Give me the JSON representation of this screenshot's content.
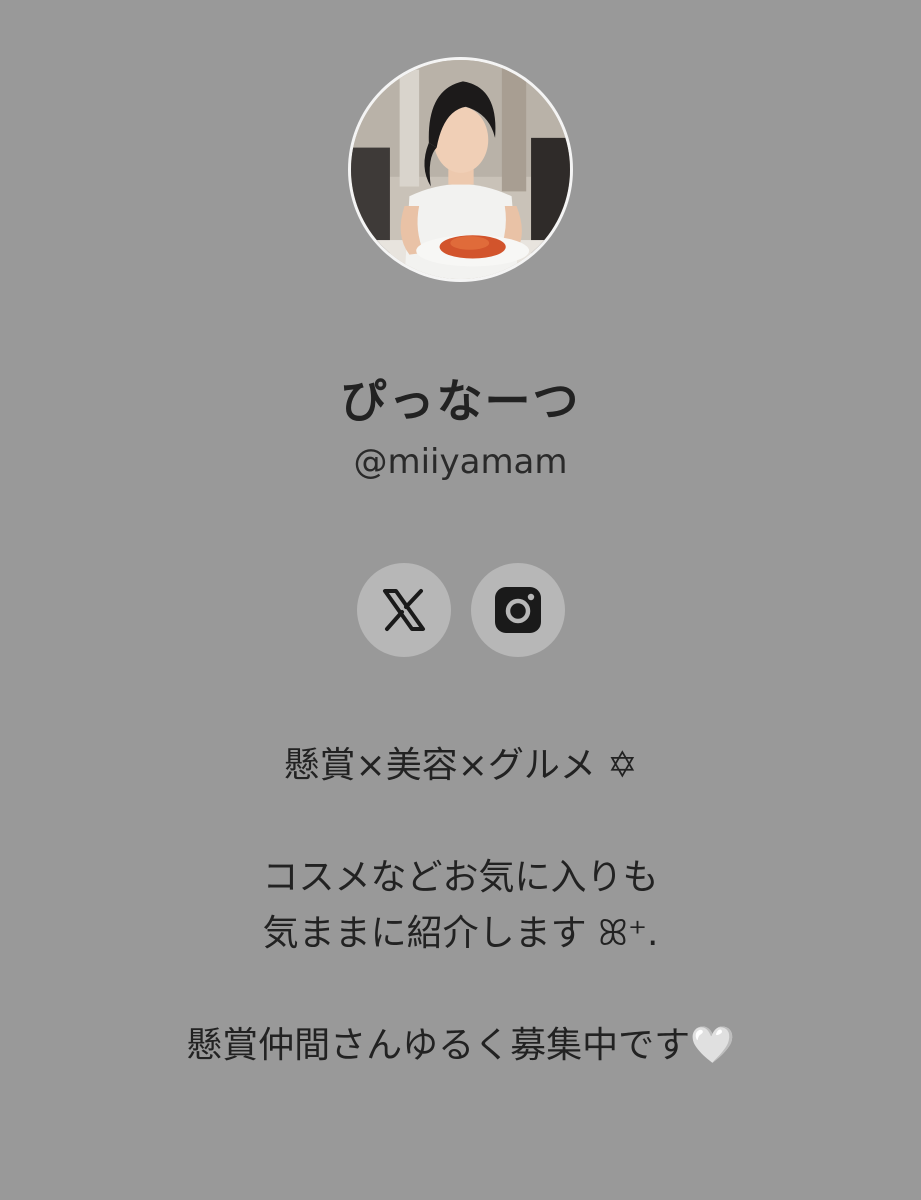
{
  "profile": {
    "avatar_alt": "avatar",
    "display_name": "ぴっなーつ",
    "handle": "@miiyamam"
  },
  "social": [
    {
      "name": "X",
      "icon": "x-logo-icon"
    },
    {
      "name": "Instagram",
      "icon": "instagram-icon"
    }
  ],
  "bio": {
    "line1": "懸賞×美容×グルメ ✡",
    "line2": "コスメなどお気に入りも",
    "line3": "気ままに紹介します ꕤ⁺.",
    "line4": "懸賞仲間さんゆるく募集中です🤍"
  },
  "colors": {
    "background": "#999999",
    "button_bg": "#b7b7b7",
    "text": "#222222"
  }
}
